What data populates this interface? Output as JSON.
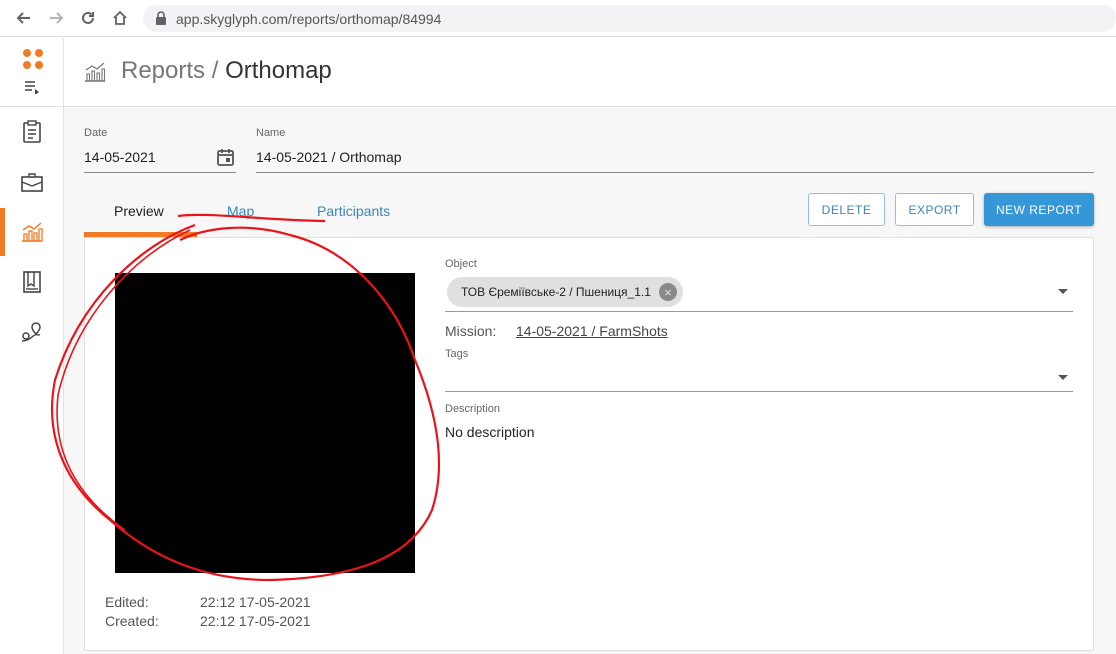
{
  "browser": {
    "url": "app.skyglyph.com/reports/orthomap/84994"
  },
  "sidebar": {
    "items": [
      {
        "icon": "clipboard-icon"
      },
      {
        "icon": "briefcase-icon"
      },
      {
        "icon": "chart-icon"
      },
      {
        "icon": "notebook-icon"
      },
      {
        "icon": "route-icon"
      }
    ],
    "active_index": 2
  },
  "header": {
    "section": "Reports",
    "separator": "/",
    "page": "Orthomap"
  },
  "form": {
    "date_label": "Date",
    "date_value": "14-05-2021",
    "name_label": "Name",
    "name_value": "14-05-2021 / Orthomap"
  },
  "tabs": [
    {
      "label": "Preview",
      "active": true
    },
    {
      "label": "Map",
      "active": false
    },
    {
      "label": "Participants",
      "active": false
    }
  ],
  "actions": {
    "delete_label": "DELETE",
    "export_label": "EXPORT",
    "new_report_label": "NEW REPORT"
  },
  "details": {
    "object_label": "Object",
    "object_chip": "ТОВ Єреміївське-2 / Пшениця_1.1",
    "mission_label": "Mission:",
    "mission_value": "14-05-2021 / FarmShots",
    "tags_label": "Tags",
    "description_label": "Description",
    "description_value": "No description"
  },
  "meta": {
    "edited_label": "Edited:",
    "edited_value": "22:12 17-05-2021",
    "created_label": "Created:",
    "created_value": "22:12 17-05-2021"
  },
  "colors": {
    "accent": "#f07b24",
    "primary": "#3596d8",
    "annotation": "#e8141a"
  }
}
